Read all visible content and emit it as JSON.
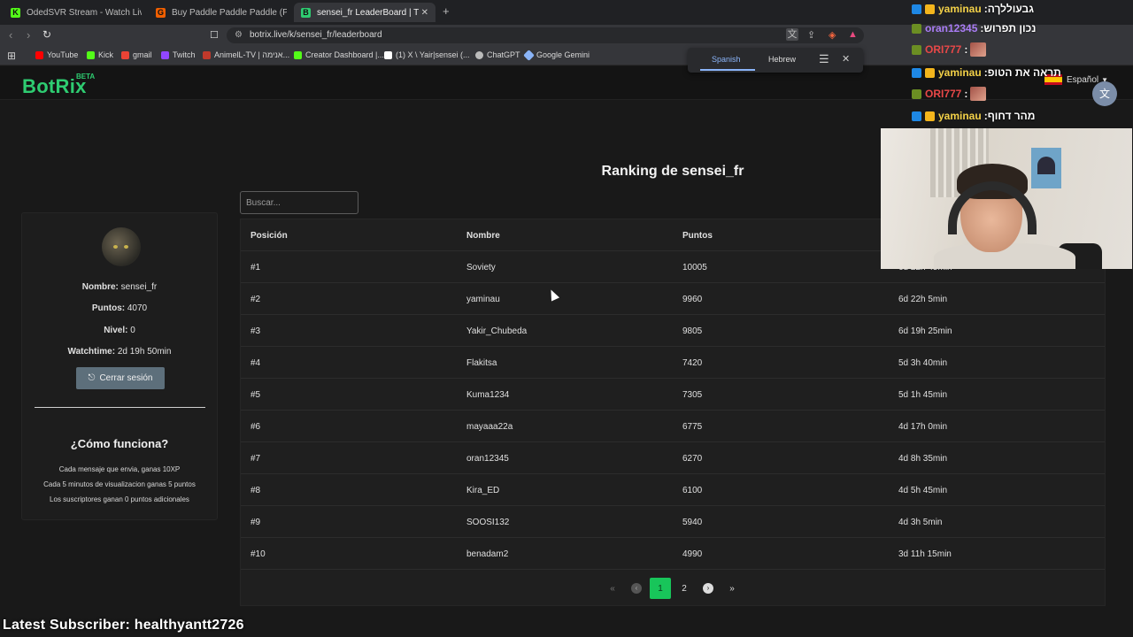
{
  "browser": {
    "tabs": [
      {
        "label": "OdedSVR Stream - Watch Live on Kic",
        "icon": "kick-icon",
        "color": "#53fc18"
      },
      {
        "label": "Buy Paddle Paddle Paddle (PC) - Stea",
        "icon": "g2a-icon",
        "color": "#f05f00"
      },
      {
        "label": "sensei_fr LeaderBoard | The best",
        "icon": "botrix-icon",
        "color": "#2ecc71",
        "active": true
      }
    ],
    "url": "botrix.live/k/sensei_fr/leaderboard",
    "bookmarks": [
      "YouTube",
      "Kick",
      "gmail",
      "Twitch",
      "AnimelL-TV | אנימה...",
      "Creator Dashboard |...",
      "(1) X \\ Yair|sensei (...",
      "ChatGPT",
      "Google Gemini"
    ]
  },
  "translate": {
    "source": "Spanish",
    "target": "Hebrew"
  },
  "site": {
    "logo": "BotRix",
    "beta": "BETA",
    "language": "Español",
    "ranking_title": "Ranking de sensei_fr",
    "search_placeholder": "Buscar..."
  },
  "profile": {
    "name_label": "Nombre:",
    "name": "sensei_fr",
    "points_label": "Puntos:",
    "points": "4070",
    "level_label": "Nivel:",
    "level": "0",
    "watchtime_label": "Watchtime:",
    "watchtime": "2d 19h 50min",
    "logout": "Cerrar sesión",
    "how_title": "¿Cómo funciona?",
    "how_lines": [
      "Cada mensaje que envia, ganas 10XP",
      "Cada 5 minutos de visualizacion ganas 5 puntos",
      "Los suscriptores ganan 0 puntos adicionales"
    ]
  },
  "table": {
    "headers": [
      "Posición",
      "Nombre",
      "Puntos",
      ""
    ],
    "rows": [
      [
        "#1",
        "Soviety",
        "10005",
        "6d 22h 45min"
      ],
      [
        "#2",
        "yaminau",
        "9960",
        "6d 22h 5min"
      ],
      [
        "#3",
        "Yakir_Chubeda",
        "9805",
        "6d 19h 25min"
      ],
      [
        "#4",
        "Flakitsa",
        "7420",
        "5d 3h 40min"
      ],
      [
        "#5",
        "Kuma1234",
        "7305",
        "5d 1h 45min"
      ],
      [
        "#6",
        "mayaaa22a",
        "6775",
        "4d 17h 0min"
      ],
      [
        "#7",
        "oran12345",
        "6270",
        "4d 8h 35min"
      ],
      [
        "#8",
        "Kira_ED",
        "6100",
        "4d 5h 45min"
      ],
      [
        "#9",
        "SOOSI132",
        "5940",
        "4d 3h 5min"
      ],
      [
        "#10",
        "benadam2",
        "4990",
        "3d 11h 15min"
      ]
    ]
  },
  "pager": {
    "pages": [
      "1",
      "2"
    ],
    "current": "1"
  },
  "overlay": {
    "chat": [
      {
        "user": "yaminau",
        "text": "גבעוללךה",
        "color": "#f3d148"
      },
      {
        "user": "oran12345",
        "text": "נכון תפרוש",
        "color": "#a97cf5"
      },
      {
        "user": "ORI777",
        "text": "",
        "color": "#e84848",
        "emote": true
      },
      {
        "user": "yaminau",
        "text": "תראה את הטופ",
        "color": "#f3d148"
      },
      {
        "user": "ORI777",
        "text": "",
        "color": "#e84848",
        "emote": true
      },
      {
        "user": "yaminau",
        "text": "מהר דחוף",
        "color": "#f3d148"
      }
    ],
    "latest_subscriber": "Latest Subscriber: healthyantt2726"
  }
}
